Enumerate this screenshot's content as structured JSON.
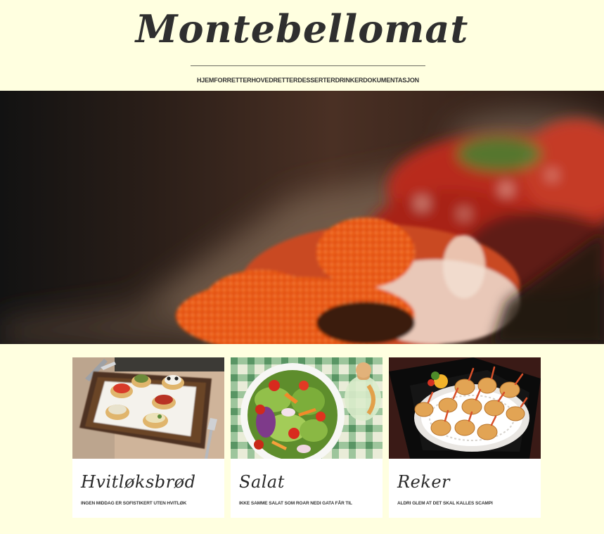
{
  "site": {
    "logo": "Montebellomat",
    "background_color": "#ffffe0"
  },
  "nav": {
    "items": [
      {
        "label": "HJEM"
      },
      {
        "label": "FORRETTER"
      },
      {
        "label": "HOVEDRETTER"
      },
      {
        "label": "DESSERTER"
      },
      {
        "label": "DRINKER"
      },
      {
        "label": "DOKUMENTASJON"
      }
    ]
  },
  "hero": {
    "image": "sushi-roll-closeup"
  },
  "cards": [
    {
      "title": "Hvitløksbrød",
      "description": "INGEN MIDDAG ER SOFISTIKERT UTEN HVITLØK",
      "image": "garlic-bread-appetizers"
    },
    {
      "title": "Salat",
      "description": "IKKE SAMME SALAT SOM ROAR NEDI GATA FÅR TIL",
      "image": "salad-bowl"
    },
    {
      "title": "Reker",
      "description": "ALDRI GLEM AT DET SKAL KALLES SCAMPI",
      "image": "fried-shrimp-platter"
    }
  ]
}
